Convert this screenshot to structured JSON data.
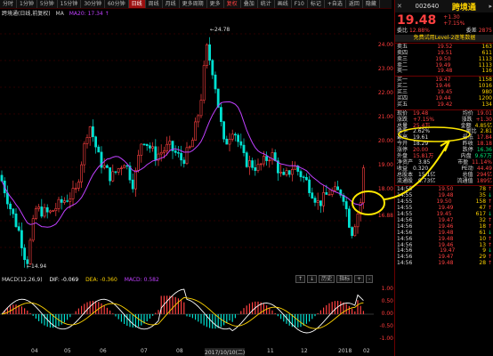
{
  "toolbar": {
    "tabs": [
      "分时",
      "1分钟",
      "5分钟",
      "15分钟",
      "30分钟",
      "60分钟",
      "日线",
      "周线",
      "月线",
      "更多周期",
      "更多"
    ],
    "active_tab": "日线",
    "overlay_tabs": [
      "复权",
      "叠加",
      "统计",
      "画线",
      "F10",
      "标记",
      "+自选",
      "返回"
    ],
    "hide_btn": "隐藏"
  },
  "chart": {
    "title": "跨境通(日线,前复权)",
    "ma_label": "MA",
    "ma20": "MA20: 17.34 ↑",
    "price_high": "24.78",
    "price_low": "14.94",
    "y_ticks": [
      "24.00",
      "23.00",
      "22.00",
      "21.00",
      "20.00",
      "19.00",
      "18.00",
      "16.88"
    ],
    "x_ticks": [
      "04",
      "05",
      "06",
      "07",
      "08",
      "09",
      "2017/10/10(二)",
      "11",
      "12",
      "2018",
      "02"
    ],
    "macd_title": "MACD(12,26,9)",
    "dif": "DIF: -0.069",
    "dea": "DEA: -0.360",
    "macd": "MACD: 0.582",
    "macd_y_ticks": [
      "1.00",
      "0.50",
      "0.00",
      "-0.50",
      "-1.00"
    ],
    "buttons": [
      "↑",
      "↓",
      "历史",
      "指标",
      "+",
      "-"
    ]
  },
  "quote": {
    "code": "002640",
    "name": "跨境通",
    "price": "19.48",
    "change": "+1.30",
    "change_pct": "+7.15%",
    "wb_label": "委比",
    "wb": "12.88%",
    "wc_label": "委差",
    "wc": "2875",
    "level2": "免费试用Level-2逐笔数据",
    "asks": [
      {
        "name": "卖五",
        "p": "19.52",
        "v": "163"
      },
      {
        "name": "卖四",
        "p": "19.51",
        "v": "611"
      },
      {
        "name": "卖三",
        "p": "19.50",
        "v": "1113"
      },
      {
        "name": "卖二",
        "p": "19.49",
        "v": "1113"
      },
      {
        "name": "卖一",
        "p": "19.48",
        "v": "116"
      }
    ],
    "bids": [
      {
        "name": "买一",
        "p": "19.47",
        "v": "1158"
      },
      {
        "name": "买二",
        "p": "19.46",
        "v": "1016"
      },
      {
        "name": "买三",
        "p": "19.45",
        "v": "980"
      },
      {
        "name": "买四",
        "p": "19.44",
        "v": "1200"
      },
      {
        "name": "买五",
        "p": "19.42",
        "v": "134"
      }
    ],
    "stats": [
      [
        "现价",
        "19.48",
        "均价",
        "19.01"
      ],
      [
        "涨跌",
        "+7.15%",
        "涨跌",
        "+1.30"
      ],
      [
        "总量",
        "25.4万",
        "金额",
        "4.85亿"
      ],
      [
        "换手",
        "2.62%",
        "量比",
        "2.81"
      ],
      [
        "最高",
        "19.61",
        "最低",
        "17.84"
      ],
      [
        "今开",
        "18.29",
        "昨收",
        "18.18"
      ],
      [
        "涨停",
        "20.00",
        "跌停",
        "16.36"
      ],
      [
        "外盘",
        "15.81万",
        "内盘",
        "9.67万"
      ],
      [
        "净资产",
        "3.85",
        "市盈",
        "11.14%"
      ],
      [
        "收益",
        "0.320",
        "PE动",
        "44.49"
      ],
      [
        "总股本",
        "15.1亿",
        "总值",
        "294亿"
      ],
      [
        "流通股",
        "9.73亿",
        "流通值",
        "189亿"
      ]
    ],
    "ticks": [
      {
        "t": "14:55",
        "p": "19.50",
        "v": "78"
      },
      {
        "t": "14:55",
        "p": "19.48",
        "v": "35"
      },
      {
        "t": "14:55",
        "p": "19.50",
        "v": "158"
      },
      {
        "t": "14:55",
        "p": "19.49",
        "v": "47"
      },
      {
        "t": "14:55",
        "p": "19.45",
        "v": "617"
      },
      {
        "t": "14:56",
        "p": "19.47",
        "v": "32"
      },
      {
        "t": "14:56",
        "p": "19.46",
        "v": "18"
      },
      {
        "t": "14:56",
        "p": "19.48",
        "v": "61"
      },
      {
        "t": "14:56",
        "p": "19.48",
        "v": "10"
      },
      {
        "t": "14:56",
        "p": "19.46",
        "v": "13"
      },
      {
        "t": "14:56",
        "p": "19.47",
        "v": "9"
      },
      {
        "t": "14:56",
        "p": "19.47",
        "v": "29"
      },
      {
        "t": "14:56",
        "p": "19.48",
        "v": "28"
      }
    ]
  },
  "colors": {
    "up": "#ff4040",
    "down": "#00e0d0",
    "ma": "#c040ff",
    "dif": "#ffffff",
    "dea": "#ffd400",
    "annotation": "#ffe800"
  }
}
